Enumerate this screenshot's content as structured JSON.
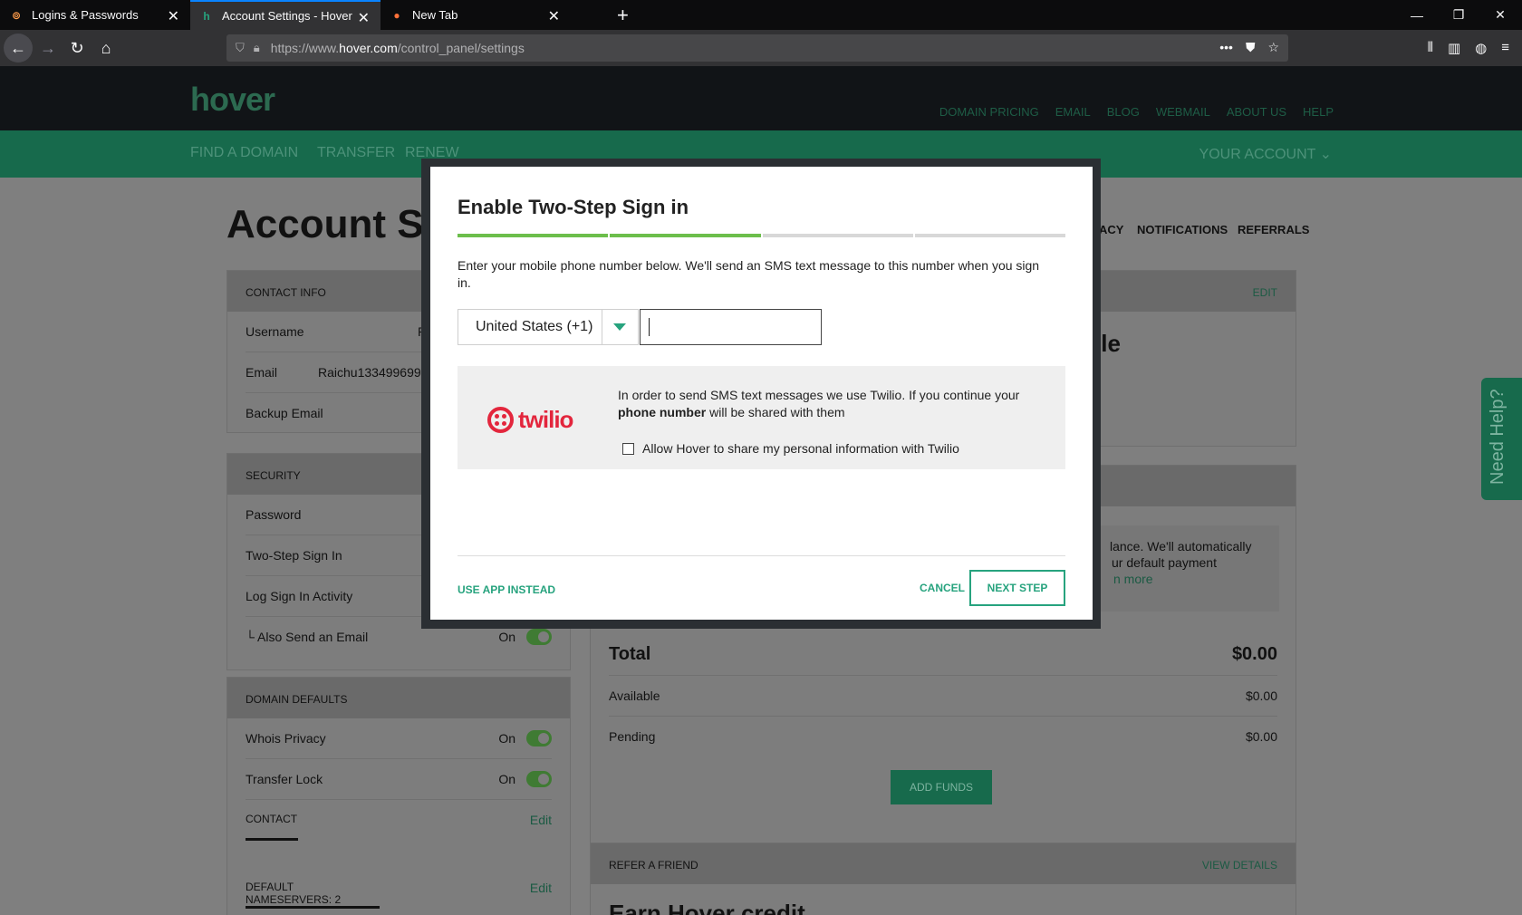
{
  "browser": {
    "tabs": [
      {
        "title": "Logins & Passwords",
        "icon": "lockwise-icon"
      },
      {
        "title": "Account Settings - Hover",
        "icon": "hover-h-icon"
      },
      {
        "title": "New Tab",
        "icon": "firefox-icon"
      }
    ],
    "url_prefix": "https://www.",
    "url_domain": "hover.com",
    "url_path": "/control_panel/settings"
  },
  "site": {
    "logo": "hover",
    "top_nav": [
      "DOMAIN PRICING",
      "EMAIL",
      "BLOG",
      "WEBMAIL",
      "ABOUT US",
      "HELP"
    ],
    "main_nav": [
      "FIND A DOMAIN",
      "TRANSFER",
      "RENEW"
    ],
    "your_account": "YOUR ACCOUNT ⌄"
  },
  "page": {
    "title": "Account Se",
    "subnav": [
      "ACY",
      "NOTIFICATIONS",
      "REFERRALS"
    ],
    "contact_info": {
      "header": "CONTACT INFO",
      "rows": [
        {
          "label": "Username",
          "value": "R"
        },
        {
          "label": "Email",
          "value": "Raichu133499699"
        },
        {
          "label": "Backup Email",
          "value": ""
        }
      ]
    },
    "security": {
      "header": "SECURITY",
      "rows": [
        "Password",
        "Two-Step Sign In",
        "Log Sign In Activity"
      ],
      "also_send": "└ Also Send an Email",
      "also_send_state": "On"
    },
    "domain_defaults": {
      "header": "DOMAIN DEFAULTS",
      "whois": "Whois Privacy",
      "whois_state": "On",
      "transfer": "Transfer Lock",
      "transfer_state": "On",
      "contact": "CONTACT",
      "contact_edit": "Edit",
      "nameservers": "DEFAULT NAMESERVERS: 2",
      "nameservers_edit": "Edit"
    },
    "right_card": {
      "edit": "EDIT",
      "partial_heading": "ile",
      "funds_text_1": "lance. We'll automatically",
      "funds_text_2": "ur default payment",
      "funds_link": "n more"
    },
    "balance": {
      "total_label": "Total",
      "total_value": "$0.00",
      "available_label": "Available",
      "available_value": "$0.00",
      "pending_label": "Pending",
      "pending_value": "$0.00",
      "add_funds": "ADD FUNDS"
    },
    "refer": {
      "header": "REFER A FRIEND",
      "view": "VIEW DETAILS",
      "partial": "Earn Hover credit"
    },
    "need_help": "Need Help?"
  },
  "modal": {
    "title": "Enable Two-Step Sign in",
    "progress_steps_total": 4,
    "progress_steps_done": 2,
    "intro": "Enter your mobile phone number below. We'll send an SMS text message to this number when you sign in.",
    "country": "United States (+1)",
    "phone_value": "",
    "twilio_logo": "twilio",
    "twilio_text_1": "In order to send SMS text messages we use Twilio. If you continue your ",
    "twilio_text_bold": "phone number",
    "twilio_text_2": " will be shared with them",
    "allow_label": "Allow Hover to share my personal information with Twilio",
    "use_app": "USE APP INSTEAD",
    "cancel": "CANCEL",
    "next": "NEXT STEP"
  },
  "colors": {
    "accent": "#27a37e",
    "progress_done": "#6cbe4b",
    "twilio_red": "#e3263d"
  }
}
